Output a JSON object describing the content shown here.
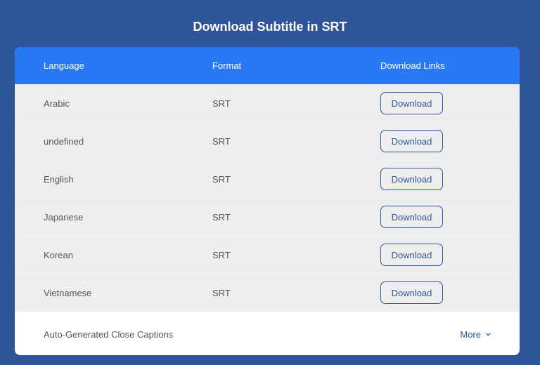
{
  "title": "Download Subtitle in SRT",
  "table": {
    "headers": {
      "language": "Language",
      "format": "Format",
      "links": "Download Links"
    },
    "rows": [
      {
        "language": "Arabic",
        "format": "SRT",
        "action": "Download"
      },
      {
        "language": "undefined",
        "format": "SRT",
        "action": "Download"
      },
      {
        "language": "English",
        "format": "SRT",
        "action": "Download"
      },
      {
        "language": "Japanese",
        "format": "SRT",
        "action": "Download"
      },
      {
        "language": "Korean",
        "format": "SRT",
        "action": "Download"
      },
      {
        "language": "Vietnamese",
        "format": "SRT",
        "action": "Download"
      }
    ]
  },
  "footer": {
    "auto_caption": "Auto-Generated Close Captions",
    "more_label": "More",
    "more_icon": "chevron-down-icon"
  },
  "colors": {
    "background": "#2e5499",
    "header": "#2979f5",
    "row": "#eeeeee",
    "button_border": "#2e5499"
  }
}
